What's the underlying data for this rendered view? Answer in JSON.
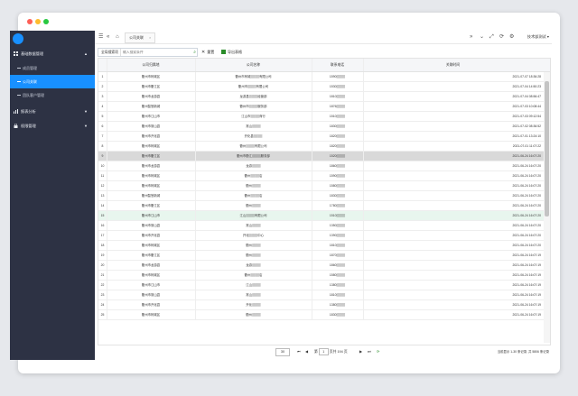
{
  "window": {
    "controls": [
      "close",
      "minimize",
      "maximize"
    ]
  },
  "sidebar": {
    "groups": [
      {
        "label": "基础数据管理",
        "icon": "grid-icon",
        "expanded": true,
        "items": [
          {
            "label": "成员管理",
            "active": false
          },
          {
            "label": "公司关联",
            "active": true
          },
          {
            "label": "团队客户管理",
            "active": false
          }
        ]
      },
      {
        "label": "报表分析",
        "icon": "chart-icon",
        "expanded": false
      },
      {
        "label": "权限管理",
        "icon": "lock-icon",
        "expanded": false
      }
    ]
  },
  "toolbar": {
    "menu_icon": "☰",
    "collapse_icon": "«",
    "home_icon": "⌂",
    "tab_label": "公司关联",
    "tab_close": "×",
    "right_icons": [
      "»",
      "⌄",
      "⤢",
      "⟳",
      "⚙"
    ],
    "user_label": "技术部测试 ▾"
  },
  "search": {
    "select_value": "全局搜索项",
    "placeholder": "输入搜索条件",
    "reset_label": "重置",
    "export_label": "导出表格"
  },
  "table": {
    "columns": [
      "公司归属地",
      "公司名称",
      "联系电话",
      "关联时间"
    ],
    "rows": [
      {
        "n": "1",
        "region": "衢州市柯城区",
        "company": "衢州市柯城▒▒▒▒有限公司",
        "phone": "1590▒▒▒▒",
        "time": "2021-07-07 18:36:28"
      },
      {
        "n": "2",
        "region": "衢州市衢江区",
        "company": "衢州市▒▒▒▒有限公司",
        "phone": "1530▒▒▒▒",
        "time": "2021-07-04 14:50:23"
      },
      {
        "n": "3",
        "region": "衢州市龙游县",
        "company": "龙游县▒▒▒▒经营部",
        "phone": "1810▒▒▒▒",
        "time": "2021-07-04 08:56:47"
      },
      {
        "n": "4",
        "region": "衢州智慧新城",
        "company": "衢州市▒▒▒▒服务部",
        "phone": "1876▒▒▒▒",
        "time": "2021-07-03 10:08:44"
      },
      {
        "n": "5",
        "region": "衢州市江山市",
        "company": "江山市▒▒▒▒商行",
        "phone": "1510▒▒▒▒",
        "time": "2021-07-03 09:12:54"
      },
      {
        "n": "6",
        "region": "衢州市常山县",
        "company": "常山▒▒▒▒",
        "phone": "1830▒▒▒▒",
        "time": "2021-07-02 08:36:52"
      },
      {
        "n": "7",
        "region": "衢州市开化县",
        "company": "开化县▒▒▒▒",
        "phone": "1820▒▒▒▒",
        "time": "2021-07-01 13:24:10"
      },
      {
        "n": "8",
        "region": "衢州市柯城区",
        "company": "衢州▒▒▒▒有限公司",
        "phone": "1820▒▒▒▒",
        "time": "2021-07-01 11:07:22"
      },
      {
        "n": "9",
        "region": "衢州市衢江区",
        "company": "衢州市衢江▒▒▒▒服务部",
        "phone": "1520▒▒▒▒",
        "time": "2021-06-24 16:07:20"
      },
      {
        "n": "10",
        "region": "衢州市龙游县",
        "company": "龙游▒▒▒▒",
        "phone": "1860▒▒▒▒",
        "time": "2021-06-24 16:07:20"
      },
      {
        "n": "11",
        "region": "衢州市柯城区",
        "company": "衢州▒▒▒▒店",
        "phone": "1590▒▒▒▒",
        "time": "2021-06-24 16:07:20"
      },
      {
        "n": "12",
        "region": "衢州市柯城区",
        "company": "衢州▒▒▒▒",
        "phone": "1580▒▒▒▒",
        "time": "2021-06-24 16:07:20"
      },
      {
        "n": "13",
        "region": "衢州智慧新城",
        "company": "衢州▒▒▒▒店",
        "phone": "1830▒▒▒▒",
        "time": "2021-06-24 16:07:20"
      },
      {
        "n": "14",
        "region": "衢州市衢江区",
        "company": "衢州▒▒▒▒",
        "phone": "1780▒▒▒▒",
        "time": "2021-06-24 16:07:20"
      },
      {
        "n": "15",
        "region": "衢州市江山市",
        "company": "江山▒▒▒▒有限公司",
        "phone": "1510▒▒▒▒",
        "time": "2021-06-24 16:07:20"
      },
      {
        "n": "16",
        "region": "衢州市常山县",
        "company": "常山▒▒▒▒",
        "phone": "1350▒▒▒▒",
        "time": "2021-06-24 16:07:20"
      },
      {
        "n": "17",
        "region": "衢州市开化县",
        "company": "开化▒▒▒▒中心",
        "phone": "1390▒▒▒▒",
        "time": "2021-06-24 16:07:20"
      },
      {
        "n": "18",
        "region": "衢州市柯城区",
        "company": "衢州▒▒▒▒",
        "phone": "1810▒▒▒▒",
        "time": "2021-06-24 16:07:20"
      },
      {
        "n": "19",
        "region": "衢州市衢江区",
        "company": "衢州▒▒▒▒",
        "phone": "1870▒▒▒▒",
        "time": "2021-06-24 16:07:19"
      },
      {
        "n": "20",
        "region": "衢州市龙游县",
        "company": "龙游▒▒▒▒",
        "phone": "1860▒▒▒▒",
        "time": "2021-06-24 16:07:19"
      },
      {
        "n": "21",
        "region": "衢州市柯城区",
        "company": "衢州▒▒▒▒店",
        "phone": "1580▒▒▒▒",
        "time": "2021-06-24 16:07:19"
      },
      {
        "n": "22",
        "region": "衢州市江山市",
        "company": "江山▒▒▒▒",
        "phone": "1380▒▒▒▒",
        "time": "2021-06-24 16:07:19"
      },
      {
        "n": "23",
        "region": "衢州市常山县",
        "company": "常山▒▒▒▒",
        "phone": "1810▒▒▒▒",
        "time": "2021-06-24 16:07:19"
      },
      {
        "n": "24",
        "region": "衢州市开化县",
        "company": "开化▒▒▒▒",
        "phone": "1380▒▒▒▒",
        "time": "2021-06-24 16:07:19"
      },
      {
        "n": "25",
        "region": "衢州市柯城区",
        "company": "衢州▒▒▒▒",
        "phone": "1830▒▒▒▒",
        "time": "2021-06-24 16:07:19"
      }
    ],
    "selected_row": 9,
    "highlighted_row": 15
  },
  "pager": {
    "page_size": "30",
    "first": "⏮",
    "prev": "◀",
    "page_prefix": "第",
    "page_value": "1",
    "page_suffix": "页共 194 页",
    "next": "▶",
    "last": "⏭",
    "refresh": "⟳",
    "summary": "当前显示 1-30 条记录, 共 5806 条记录"
  },
  "colors": {
    "sidebar_bg": "#2d3244",
    "accent": "#1890ff",
    "selected_row": "#d9d9d9",
    "highlight_row": "#e8f6ee"
  }
}
